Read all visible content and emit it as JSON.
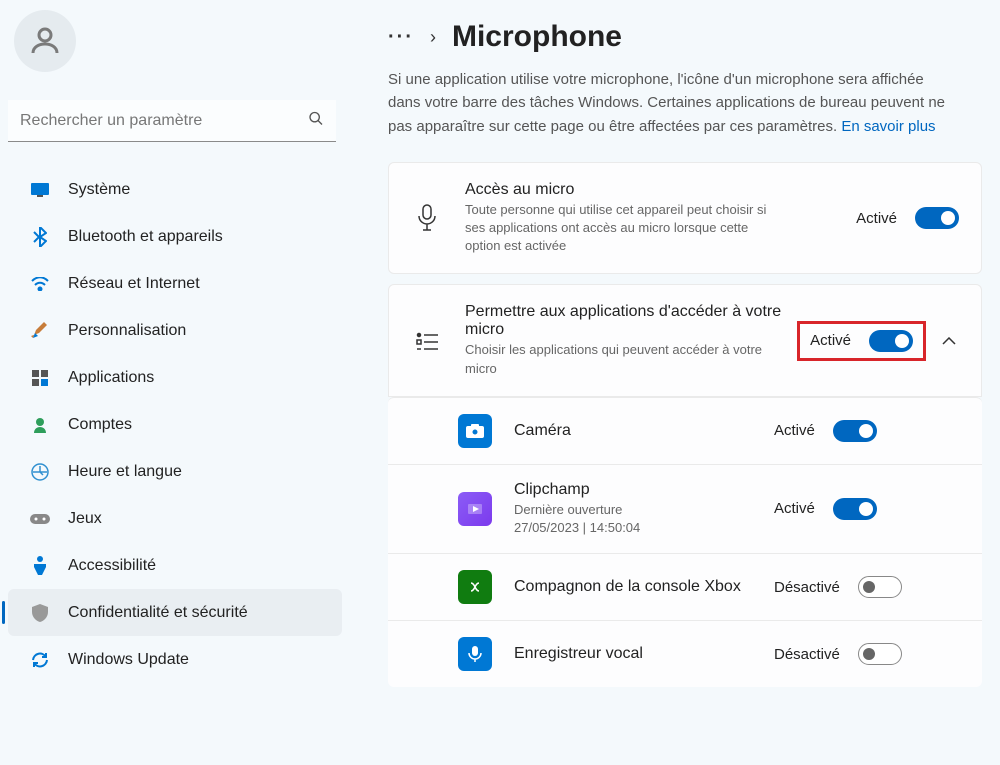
{
  "sidebar": {
    "search_placeholder": "Rechercher un paramètre",
    "items": [
      {
        "label": "Système"
      },
      {
        "label": "Bluetooth et appareils"
      },
      {
        "label": "Réseau et Internet"
      },
      {
        "label": "Personnalisation"
      },
      {
        "label": "Applications"
      },
      {
        "label": "Comptes"
      },
      {
        "label": "Heure et langue"
      },
      {
        "label": "Jeux"
      },
      {
        "label": "Accessibilité"
      },
      {
        "label": "Confidentialité et sécurité"
      },
      {
        "label": "Windows Update"
      }
    ]
  },
  "header": {
    "title": "Microphone"
  },
  "description": {
    "text": "Si une application utilise votre microphone, l'icône d'un microphone sera affichée dans votre barre des tâches Windows. Certaines applications de bureau peuvent ne pas apparaître sur cette page ou être affectées par ces paramètres.  ",
    "link": "En savoir plus"
  },
  "panel_access": {
    "title": "Accès au micro",
    "subtitle": "Toute personne qui utilise cet appareil peut choisir si ses applications ont accès au micro lorsque cette option est activée",
    "state": "Activé"
  },
  "panel_apps": {
    "title": "Permettre aux applications d'accéder à votre micro",
    "subtitle": "Choisir les applications qui peuvent accéder à votre micro",
    "state": "Activé"
  },
  "apps": [
    {
      "name": "Caméra",
      "sub": "",
      "state": "Activé",
      "on": true,
      "icon": "camera"
    },
    {
      "name": "Clipchamp",
      "sub": "Dernière ouverture\n27/05/2023  |  14:50:04",
      "state": "Activé",
      "on": true,
      "icon": "clipchamp"
    },
    {
      "name": "Compagnon de la console Xbox",
      "sub": "",
      "state": "Désactivé",
      "on": false,
      "icon": "xbox"
    },
    {
      "name": "Enregistreur vocal",
      "sub": "",
      "state": "Désactivé",
      "on": false,
      "icon": "voice"
    }
  ]
}
